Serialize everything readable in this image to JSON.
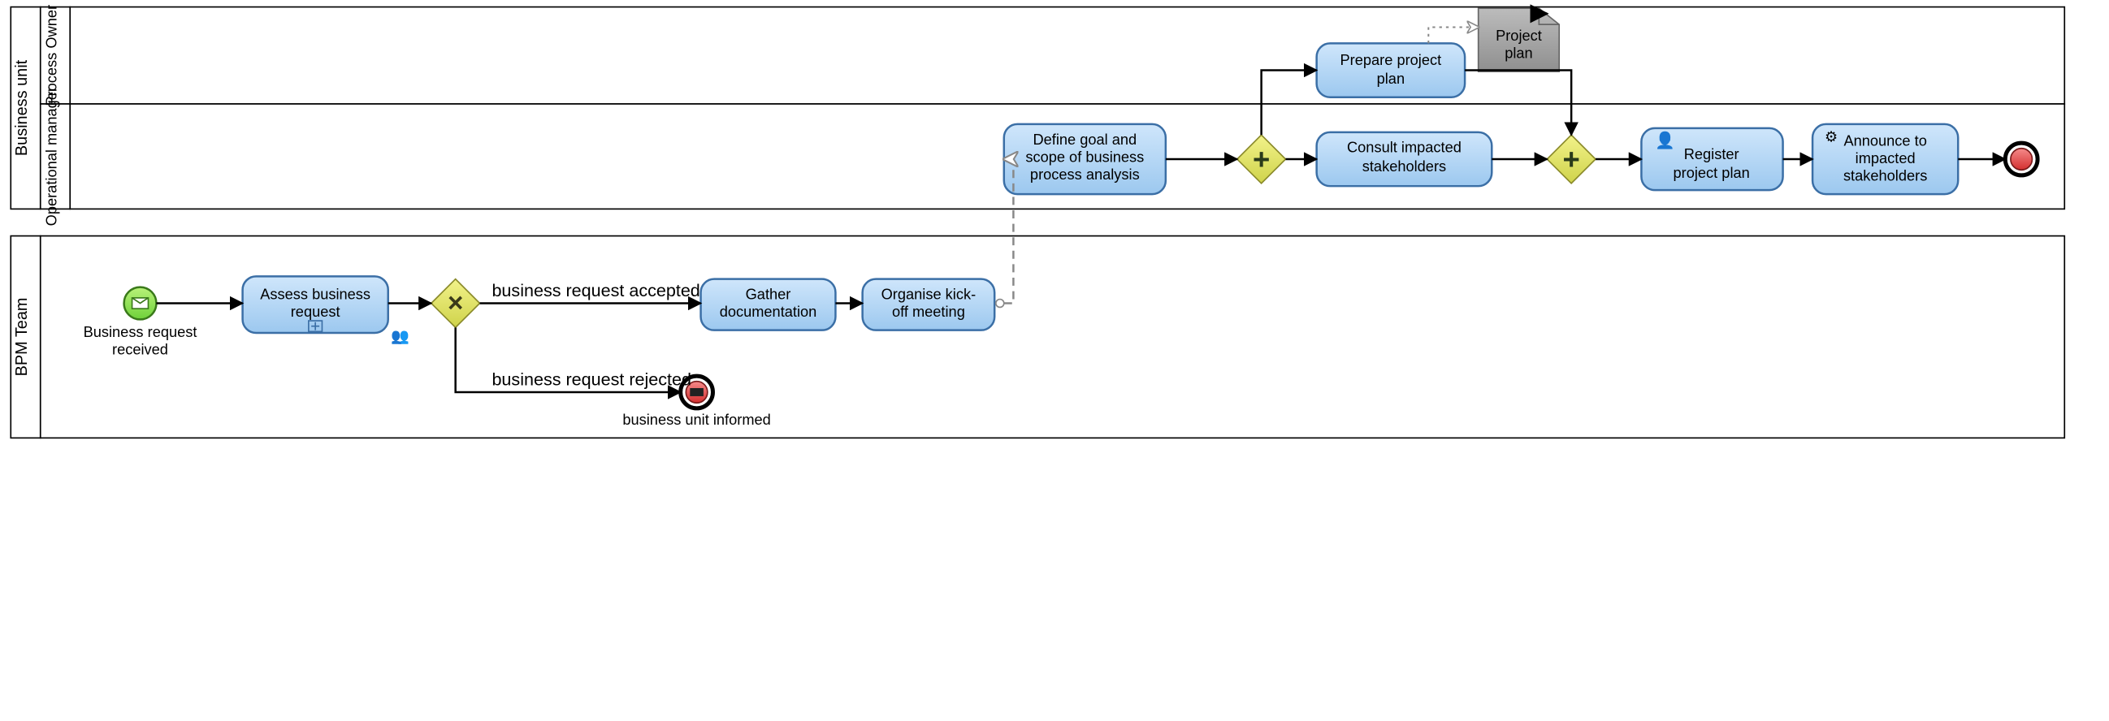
{
  "chart_data": {
    "type": "bpmn-process-diagram",
    "pools": [
      {
        "name": "Business unit",
        "lanes": [
          {
            "name": "Process Owner",
            "elements": [
              {
                "id": "task_prepare_plan",
                "type": "task",
                "label": "Prepare project plan"
              },
              {
                "id": "artifact_project_plan",
                "type": "data-object",
                "label": "Project plan"
              }
            ]
          },
          {
            "name": "Operational manager",
            "elements": [
              {
                "id": "task_define_goal",
                "type": "task",
                "label": "Define goal and scope of business process analysis"
              },
              {
                "id": "gw_par_split",
                "type": "parallel-gateway"
              },
              {
                "id": "task_consult",
                "type": "task",
                "label": "Consult impacted stakeholders"
              },
              {
                "id": "gw_par_join",
                "type": "parallel-gateway"
              },
              {
                "id": "task_register",
                "type": "user-task",
                "label": "Register project plan"
              },
              {
                "id": "task_announce",
                "type": "service-task",
                "label": "Announce to impacted stakeholders"
              },
              {
                "id": "end_bu",
                "type": "end-event"
              }
            ]
          }
        ]
      },
      {
        "name": "BPM Team",
        "lanes": [
          {
            "name": "",
            "elements": [
              {
                "id": "start_bpm",
                "type": "message-start-event",
                "label": "Business request received"
              },
              {
                "id": "task_assess",
                "type": "sub-process",
                "label": "Assess business request"
              },
              {
                "id": "gw_xor",
                "type": "exclusive-gateway"
              },
              {
                "id": "task_gather",
                "type": "task",
                "label": "Gather documentation"
              },
              {
                "id": "task_kickoff",
                "type": "task",
                "label": "Organise kick-off meeting"
              },
              {
                "id": "end_reject",
                "type": "message-end-event",
                "label": "business unit informed"
              }
            ]
          }
        ]
      }
    ],
    "sequence_flows": [
      {
        "from": "start_bpm",
        "to": "task_assess"
      },
      {
        "from": "task_assess",
        "to": "gw_xor"
      },
      {
        "from": "gw_xor",
        "to": "task_gather",
        "condition": "business request accepted"
      },
      {
        "from": "gw_xor",
        "to": "end_reject",
        "condition": "business request rejected"
      },
      {
        "from": "task_gather",
        "to": "task_kickoff"
      },
      {
        "from": "task_define_goal",
        "to": "gw_par_split"
      },
      {
        "from": "gw_par_split",
        "to": "task_prepare_plan"
      },
      {
        "from": "gw_par_split",
        "to": "task_consult"
      },
      {
        "from": "task_consult",
        "to": "gw_par_join"
      },
      {
        "from": "task_prepare_plan",
        "to": "gw_par_join"
      },
      {
        "from": "gw_par_join",
        "to": "task_register"
      },
      {
        "from": "task_register",
        "to": "task_announce"
      },
      {
        "from": "task_announce",
        "to": "end_bu"
      }
    ],
    "message_flows": [
      {
        "from": "task_kickoff",
        "to": "task_define_goal"
      }
    ],
    "associations": [
      {
        "from": "task_prepare_plan",
        "to": "artifact_project_plan"
      }
    ]
  },
  "labels": {
    "pool_bu": "Business unit",
    "lane_po": "Process Owner",
    "lane_om": "Operational manager",
    "pool_bpm": "BPM Team",
    "start_bpm_1": "Business request",
    "start_bpm_2": "received",
    "task_assess_1": "Assess business",
    "task_assess_2": "request",
    "cond_accepted": "business request accepted",
    "cond_rejected": "business request rejected",
    "task_gather_1": "Gather",
    "task_gather_2": "documentation",
    "task_kickoff_1": "Organise kick-",
    "task_kickoff_2": "off meeting",
    "end_reject": "business unit informed",
    "task_define_1": "Define goal and",
    "task_define_2": "scope of business",
    "task_define_3": "process analysis",
    "task_prepare_1": "Prepare project",
    "task_prepare_2": "plan",
    "artifact_1": "Project",
    "artifact_2": "plan",
    "task_consult_1": "Consult impacted",
    "task_consult_2": "stakeholders",
    "task_register_1": "Register",
    "task_register_2": "project plan",
    "task_announce_1": "Announce to",
    "task_announce_2": "impacted",
    "task_announce_3": "stakeholders"
  }
}
